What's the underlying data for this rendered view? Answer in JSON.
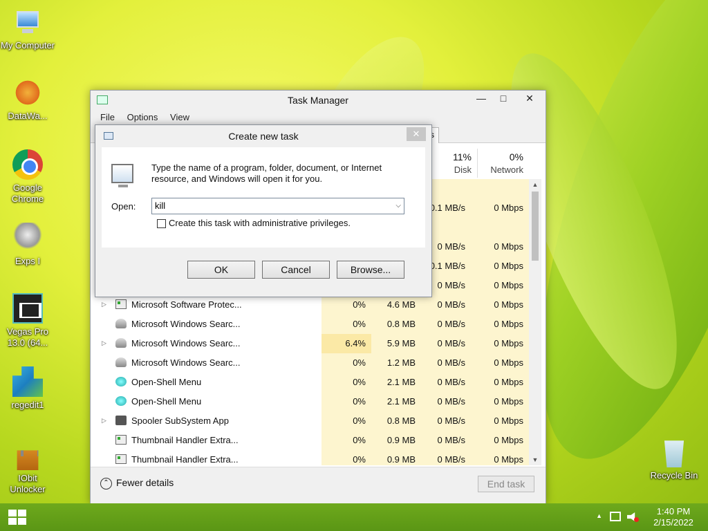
{
  "desktop": {
    "icons": [
      {
        "label": "My Computer",
        "icon": "my-computer-icon"
      },
      {
        "label": "DataWa...",
        "icon": "datawarehouse-icon"
      },
      {
        "label": "Google Chrome",
        "icon": "chrome-icon"
      },
      {
        "label": "Exps I",
        "icon": "exps-icon"
      },
      {
        "label": "Vegas Pro 13.0 (64...",
        "icon": "vegas-pro-icon"
      },
      {
        "label": "regedit1",
        "icon": "regedit-icon"
      },
      {
        "label": "IObit Unlocker",
        "icon": "iobit-unlocker-icon"
      },
      {
        "label": "Recycle Bin",
        "icon": "recycle-bin-icon"
      }
    ]
  },
  "task_manager": {
    "title": "Task Manager",
    "menu": [
      "File",
      "Options",
      "View"
    ],
    "tab_fragment": "s",
    "columns": {
      "disk": {
        "pct": "11%",
        "name": "Disk"
      },
      "network": {
        "pct": "0%",
        "name": "Network"
      }
    },
    "partial_rows": [
      {
        "disk": "",
        "network": ""
      },
      {
        "disk": "0.1 MB/s",
        "network": "0 Mbps"
      },
      {
        "disk": "",
        "network": ""
      },
      {
        "disk": "0 MB/s",
        "network": "0 Mbps"
      },
      {
        "disk": "0.1 MB/s",
        "network": "0 Mbps"
      },
      {
        "disk": "0 MB/s",
        "network": "0 Mbps"
      }
    ],
    "rows": [
      {
        "expand": "▷",
        "icon": "app",
        "name": "Microsoft Software Protec...",
        "cpu": "0%",
        "mem": "4.6 MB",
        "disk": "0 MB/s",
        "net": "0 Mbps"
      },
      {
        "expand": "",
        "icon": "user",
        "name": "Microsoft Windows Searc...",
        "cpu": "0%",
        "mem": "0.8 MB",
        "disk": "0 MB/s",
        "net": "0 Mbps"
      },
      {
        "expand": "▷",
        "icon": "user",
        "name": "Microsoft Windows Searc...",
        "cpu": "6.4%",
        "mem": "5.9 MB",
        "disk": "0 MB/s",
        "net": "0 Mbps"
      },
      {
        "expand": "",
        "icon": "user",
        "name": "Microsoft Windows Searc...",
        "cpu": "0%",
        "mem": "1.2 MB",
        "disk": "0 MB/s",
        "net": "0 Mbps"
      },
      {
        "expand": "",
        "icon": "shell",
        "name": "Open-Shell Menu",
        "cpu": "0%",
        "mem": "2.1 MB",
        "disk": "0 MB/s",
        "net": "0 Mbps"
      },
      {
        "expand": "",
        "icon": "shell",
        "name": "Open-Shell Menu",
        "cpu": "0%",
        "mem": "2.1 MB",
        "disk": "0 MB/s",
        "net": "0 Mbps"
      },
      {
        "expand": "▷",
        "icon": "print",
        "name": "Spooler SubSystem App",
        "cpu": "0%",
        "mem": "0.8 MB",
        "disk": "0 MB/s",
        "net": "0 Mbps"
      },
      {
        "expand": "",
        "icon": "app",
        "name": "Thumbnail Handler Extra...",
        "cpu": "0%",
        "mem": "0.9 MB",
        "disk": "0 MB/s",
        "net": "0 Mbps"
      },
      {
        "expand": "",
        "icon": "app",
        "name": "Thumbnail Handler Extra...",
        "cpu": "0%",
        "mem": "0.9 MB",
        "disk": "0 MB/s",
        "net": "0 Mbps"
      }
    ],
    "fewer_details": "Fewer details",
    "end_task": "End task"
  },
  "dialog": {
    "title": "Create new task",
    "message": "Type the name of a program, folder, document, or Internet resource, and Windows will open it for you.",
    "open_label": "Open:",
    "open_value": "kill",
    "admin_checkbox": "Create this task with administrative privileges.",
    "ok": "OK",
    "cancel": "Cancel",
    "browse": "Browse..."
  },
  "taskbar": {
    "time": "1:40 PM",
    "date": "2/15/2022"
  }
}
